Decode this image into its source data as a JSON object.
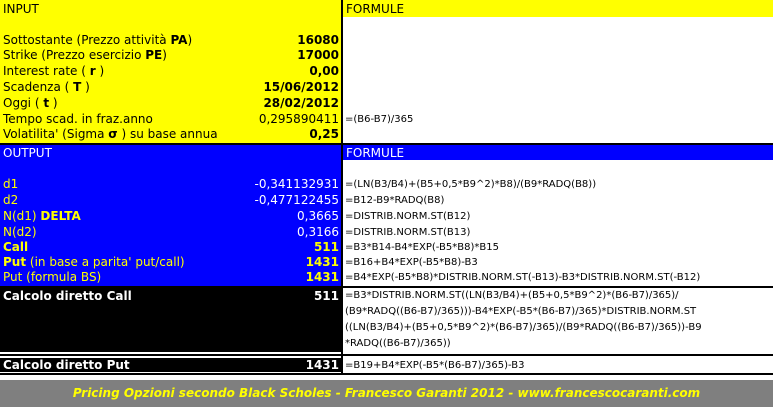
{
  "input": {
    "header": "INPUT",
    "formule_header": "FORMULE",
    "rows": [
      {
        "pre": "Sottostante (Prezzo attività ",
        "key": "PA",
        "post": ")",
        "value": "16080"
      },
      {
        "pre": "Strike (Prezzo esercizio ",
        "key": "PE",
        "post": ")",
        "value": "17000"
      },
      {
        "pre": "Interest rate ( ",
        "key": "r",
        "post": " )",
        "value": "0,00"
      },
      {
        "pre": "Scadenza ( ",
        "key": "T",
        "post": " )",
        "value": "15/06/2012"
      },
      {
        "pre": "Oggi ( ",
        "key": "t",
        "post": " )",
        "value": "28/02/2012"
      },
      {
        "pre": "Tempo scad. in fraz.anno",
        "key": "",
        "post": "",
        "value": "0,295890411"
      },
      {
        "pre": "Volatilita' (Sigma  ",
        "key": "σ",
        "post": " ) su base annua",
        "value": "0,25"
      }
    ],
    "tempo_formula": "=(B6-B7)/365"
  },
  "output": {
    "header": "OUTPUT",
    "formule_header": "FORMULE",
    "rows": [
      {
        "label": "d1",
        "bold": "",
        "value": "-0,341132931",
        "formula": "=(LN(B3/B4)+(B5+0,5*B9^2)*B8)/(B9*RADQ(B8))"
      },
      {
        "label": "d2",
        "bold": "",
        "value": "-0,477122455",
        "formula": "=B12-B9*RADQ(B8)"
      },
      {
        "label": "N(d1)  ",
        "bold": "DELTA",
        "value": "0,3665",
        "formula": "=DISTRIB.NORM.ST(B12)"
      },
      {
        "label": "N(d2)",
        "bold": "",
        "value": "0,3166",
        "formula": "=DISTRIB.NORM.ST(B13)"
      },
      {
        "label": "",
        "bold": "Call",
        "value": "511",
        "formula": "=B3*B14-B4*EXP(-B5*B8)*B15"
      },
      {
        "label": " (in base a parita' put/call)",
        "bold": "Put",
        "value": "1431",
        "formula": "=B16+B4*EXP(-B5*B8)-B3"
      },
      {
        "label": "Put (formula BS)",
        "bold": "",
        "value": "1431",
        "formula": "=B4*EXP(-B5*B8)*DISTRIB.NORM.ST(-B13)-B3*DISTRIB.NORM.ST(-B12)"
      }
    ]
  },
  "call_direct": {
    "label": "Calcolo diretto Call",
    "value": "511",
    "formula_lines": [
      "=B3*DISTRIB.NORM.ST((LN(B3/B4)+(B5+0,5*B9^2)*(B6-B7)/365)/",
      "(B9*RADQ((B6-B7)/365)))-B4*EXP(-B5*(B6-B7)/365)*DISTRIB.NORM.ST",
      "((LN(B3/B4)+(B5+0,5*B9^2)*(B6-B7)/365)/(B9*RADQ((B6-B7)/365))-B9",
      "*RADQ((B6-B7)/365))"
    ]
  },
  "put_direct": {
    "label": "Calcolo diretto Put",
    "value": "1431",
    "formula": "=B19+B4*EXP(-B5*(B6-B7)/365)-B3"
  },
  "footer": "Pricing Opzioni secondo Black Scholes  -  Francesco Garanti 2012  -  www.francescocaranti.com",
  "colors": {
    "input_bg": "#ffff00",
    "output_bg": "#0000ff",
    "output_text": "#ffffff",
    "output_accent": "#ffff00",
    "direct_bg": "#000000",
    "footer_bg": "#7f7f7f",
    "footer_text": "#ffff00"
  }
}
